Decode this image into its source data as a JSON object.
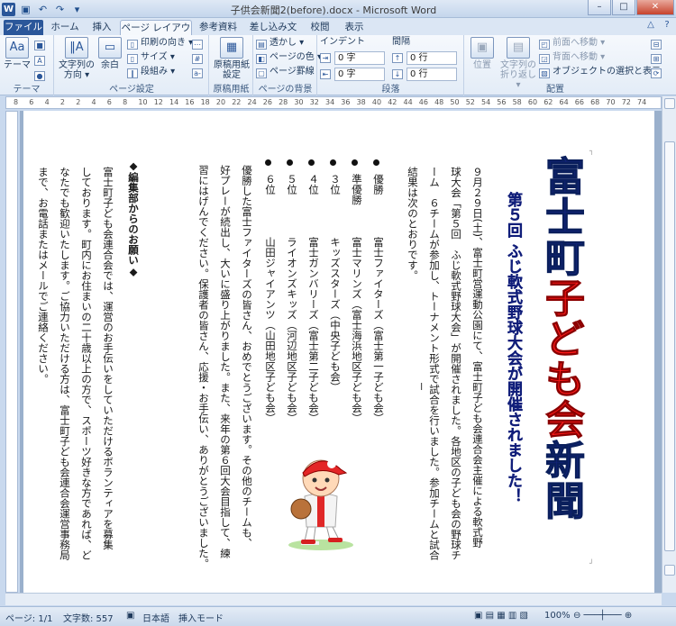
{
  "window": {
    "title": "子供会新聞2(before).docx - Microsoft Word",
    "qat_icons": [
      "word-logo-icon",
      "save-icon",
      "undo-icon",
      "redo-icon",
      "customize-icon"
    ],
    "buttons": {
      "minimize": "–",
      "maximize": "□",
      "close": "✕"
    }
  },
  "tabs": [
    "ファイル",
    "ホーム",
    "挿入",
    "ページ レイアウト",
    "参考資料",
    "差し込み文書",
    "校閲",
    "表示"
  ],
  "active_tab": "ページ レイアウト",
  "ribbon": {
    "theme": {
      "themes": "テーマ",
      "group": "テーマ"
    },
    "page_setup": {
      "direction": "文字列の方向 ▾",
      "margins": "余白",
      "orientation": "印刷の向き ▾",
      "size": "サイズ ▾",
      "columns": "段組み ▾",
      "group": "ページ設定"
    },
    "manuscript": {
      "button": "原稿用紙設定",
      "group": "原稿用紙"
    },
    "background": {
      "watermark": "透かし ▾",
      "page_color": "ページの色 ▾",
      "page_border": "ページ罫線",
      "group": "ページの背景"
    },
    "paragraph": {
      "indent": "インデント",
      "spacing": "間隔",
      "indent_left": "0 字",
      "indent_right": "0 字",
      "space_before": "0 行",
      "space_after": "0 行",
      "group": "段落"
    },
    "arrange": {
      "position": "位置",
      "wrap": "文字列の折り返し ▾",
      "front": "前面へ移動 ▾",
      "back": "背面へ移動 ▾",
      "selection": "オブジェクトの選択と表示",
      "group": "配置"
    }
  },
  "ruler_marks": [
    "8",
    "6",
    "4",
    "2",
    "2",
    "4",
    "6",
    "8",
    "10",
    "12",
    "14",
    "16",
    "18",
    "20",
    "22",
    "24",
    "26",
    "28",
    "30",
    "32",
    "34",
    "36",
    "38",
    "40",
    "42",
    "44",
    "46",
    "48",
    "50",
    "52",
    "54",
    "56",
    "58",
    "60",
    "62",
    "64",
    "66",
    "68",
    "70",
    "72",
    "74"
  ],
  "document": {
    "title_part1": "富士町",
    "title_part2": "子ども会",
    "title_part3": "新聞",
    "subtitle": "第５回 ふじ軟式野球大会が開催されました！",
    "para1": [
      "９月２９日(土)、富士町営運動公園にて、富士町子ども会連合会主催による軟式野",
      "球大会「第５回　ふじ軟式野球大会」が開催されました。各地区の子ども会の野球チ",
      "ーム　６チームが参加し、トーナメント形式で試合を行いました。参加チームと試合",
      "結果は次のとおりです。"
    ],
    "results": [
      {
        "rank": "優勝",
        "team": "富士ファイターズ（富士第一子ども会）"
      },
      {
        "rank": "準優勝",
        "team": "富士マリンズ（富士海浜地区子ども会）"
      },
      {
        "rank": "３位",
        "team": "キッズスターズ（中央子ども会）"
      },
      {
        "rank": "４位",
        "team": "富士ガンバリーズ（富士第二子ども会）"
      },
      {
        "rank": "５位",
        "team": "ライオンズキッズ（河辺地区子ども会）"
      },
      {
        "rank": "６位",
        "team": "山田ジャイアンツ（山田地区子ども会）"
      }
    ],
    "para2": [
      "優勝した富士ファイターズの皆さん、おめでとうございます。その他のチームも、",
      "好プレーが続出し、大いに盛り上がりました。また、来年の第６回大会目指して、練",
      "習にはげんでください。保護者の皆さん、応援・お手伝い、ありがとうございました。"
    ],
    "request_heading": "◆編集部からのお願い◆",
    "para3": [
      "富士町子ども会連合会では、運営のお手伝いをしていただけるボランティアを募集",
      "しております。町内にお住まいの二十歳以上の方で、スポーツ好きな方であれば、ど",
      "なたでも歓迎いたします。ご協力いただける方は、富士町子ども会連合会運営事務局",
      "まで、お電話またはメールでご連絡ください。"
    ],
    "title_colors": {
      "navy": "#12237a",
      "red": "#ff1a1a",
      "subtitle": "#111e7a"
    }
  },
  "status": {
    "page": "ページ: 1/1",
    "words": "文字数: 557",
    "lang": "日本語",
    "mode": "挿入モード",
    "zoom": "100%"
  }
}
